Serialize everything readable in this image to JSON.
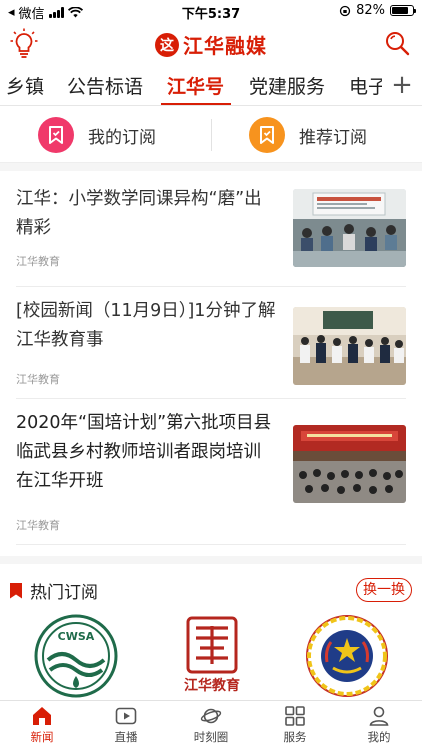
{
  "status_bar": {
    "carrier": "微信",
    "time": "下午5:37",
    "battery": "82%",
    "battery_level": 0.82
  },
  "header": {
    "logo_mark": "这",
    "logo_text": "江华融媒"
  },
  "channels": {
    "tabs": [
      {
        "label": "乡镇"
      },
      {
        "label": "公告标语"
      },
      {
        "label": "江华号"
      },
      {
        "label": "党建服务"
      },
      {
        "label": "电子"
      }
    ],
    "active_index": 2,
    "more_symbol": "+"
  },
  "subscriptions": {
    "mine_label": "我的订阅",
    "recommend_label": "推荐订阅",
    "mine_color": "#f0396a",
    "recommend_color": "#f7931e"
  },
  "news": [
    {
      "title": "江华：小学数学同课异构“磨”出精彩",
      "source": "江华教育",
      "image": "classroom-photo"
    },
    {
      "title": "[校园新闻（11月9日）]1分钟了解江华教育事",
      "source": "江华教育",
      "image": "students-activity-photo"
    },
    {
      "title": "2020年“国培计划”第六批项目县临武县乡村教师培训者跟岗培训在江华开班",
      "source": "江华教育",
      "image": "meeting-hall-photo"
    }
  ],
  "hot": {
    "title": "热门订阅",
    "swap_label": "换一换",
    "logos": [
      {
        "name": "cwsa-logo",
        "text": "CWSA"
      },
      {
        "name": "jianghua-education-logo",
        "text": "江华教育"
      },
      {
        "name": "police-badge-logo",
        "text": ""
      }
    ]
  },
  "bottom_nav": {
    "items": [
      {
        "label": "新闻",
        "icon": "home-icon"
      },
      {
        "label": "直播",
        "icon": "play-icon"
      },
      {
        "label": "时刻圈",
        "icon": "planet-icon"
      },
      {
        "label": "服务",
        "icon": "grid-icon"
      },
      {
        "label": "我的",
        "icon": "user-icon"
      }
    ],
    "active_index": 0
  },
  "colors": {
    "accent": "#d81e06"
  }
}
